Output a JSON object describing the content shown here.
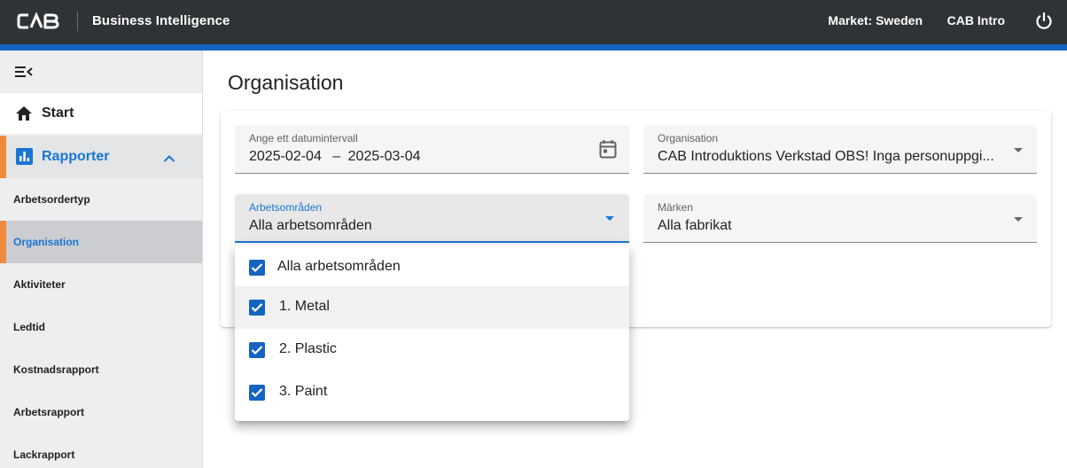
{
  "header": {
    "logo_text": "CAB",
    "app_title": "Business Intelligence",
    "market": "Market: Sweden",
    "user": "CAB Intro",
    "colors": {
      "bar": "#2f3336",
      "accent": "#1565c0"
    }
  },
  "sidebar": {
    "start_label": "Start",
    "group_label": "Rapporter",
    "items": [
      {
        "label": "Arbetsordertyp"
      },
      {
        "label": "Organisation",
        "active": true
      },
      {
        "label": "Aktiviteter"
      },
      {
        "label": "Ledtid"
      },
      {
        "label": "Kostnadsrapport"
      },
      {
        "label": "Arbetsrapport"
      },
      {
        "label": "Lackrapport"
      }
    ],
    "colors": {
      "active_marker": "#f08a3c",
      "active_text": "#1976d2"
    }
  },
  "main": {
    "title": "Organisation",
    "date_field": {
      "label": "Ange ett datumintervall",
      "start": "2025-02-04",
      "separator": "–",
      "end": "2025-03-04"
    },
    "org_field": {
      "label": "Organisation",
      "value": "CAB Introduktions Verkstad OBS! Inga personuppgi..."
    },
    "area_field": {
      "label": "Arbetsområden",
      "value": "Alla arbetsområden"
    },
    "brand_field": {
      "label": "Märken",
      "value": "Alla fabrikat"
    }
  },
  "dropdown": {
    "options": [
      {
        "label": "Alla arbetsområden",
        "checked": true
      },
      {
        "label": "1. Metal",
        "checked": true
      },
      {
        "label": "2. Plastic",
        "checked": true
      },
      {
        "label": "3. Paint",
        "checked": true
      }
    ]
  }
}
